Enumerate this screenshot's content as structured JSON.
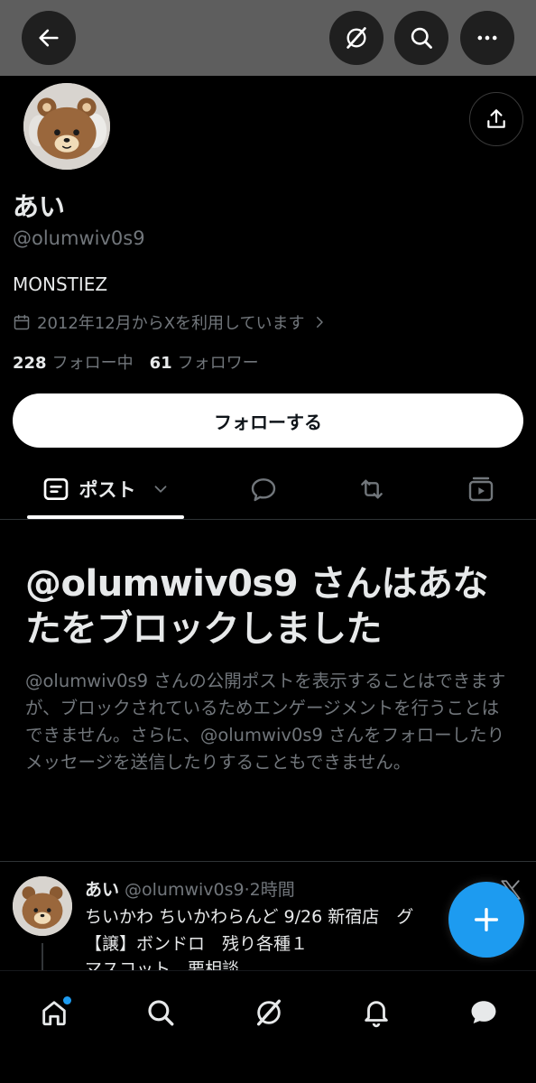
{
  "profile": {
    "display_name": "あい",
    "handle": "@olumwiv0s9",
    "bio": "MONSTIEZ",
    "joined": "2012年12月からXを利用しています",
    "following_count": "228",
    "following_label": "フォロー中",
    "followers_count": "61",
    "followers_label": "フォロワー"
  },
  "follow_button": {
    "label": "フォローする"
  },
  "tabs": {
    "posts_label": "ポスト"
  },
  "blocked": {
    "title": "@olumwiv0s9 さんはあなたをブロックしました",
    "description": "@olumwiv0s9 さんの公開ポストを表示することはできますが、ブロックされているためエンゲージメントを行うことはできません。さらに、@olumwiv0s9 さんをフォローしたりメッセージを送信したりすることもできません。"
  },
  "post": {
    "author_name": "あい",
    "author_handle": "@olumwiv0s9",
    "separator": "·",
    "time": "2時間",
    "line1": "ちいかわ ちいかわらんど 9/26 新宿店　グ",
    "line2": "【譲】ボンドロ　残り各種１",
    "line3": "マスコット　要相談"
  },
  "icons": {
    "back": "arrow-left-icon",
    "grok": "grok-icon",
    "search": "search-icon",
    "more": "more-dots-icon",
    "share": "share-icon",
    "calendar": "calendar-icon",
    "chevron": "chevron-right-icon",
    "tab_posts": "posts-icon",
    "tab_replies": "reply-bubble-icon",
    "tab_reposts": "repost-icon",
    "tab_media": "video-icon",
    "compose": "plus-icon",
    "nav_home": "home-icon",
    "nav_search": "search-icon",
    "nav_grok": "grok-icon",
    "nav_notifications": "bell-icon",
    "nav_messages": "chat-bubble-icon",
    "brand": "x-logo-icon"
  },
  "colors": {
    "background": "#000000",
    "accent": "#1d9bf0",
    "primary_text": "#e7e9ea",
    "secondary_text": "#71767b",
    "banner": "#5e5e5e"
  }
}
